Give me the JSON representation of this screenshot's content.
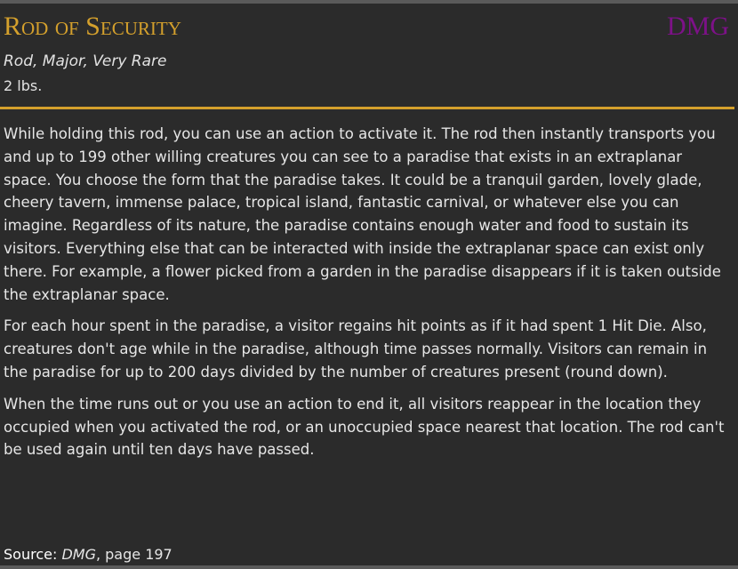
{
  "item": {
    "name": "Rod of Security",
    "source_badge": "DMG",
    "type_line": "Rod, Major, Very Rare",
    "weight": "2 lbs."
  },
  "description": [
    "While holding this rod, you can use an action to activate it. The rod then instantly transports you and up to 199 other willing creatures you can see to a paradise that exists in an extraplanar space. You choose the form that the paradise takes. It could be a tranquil garden, lovely glade, cheery tavern, immense palace, tropical island, fantastic carnival, or whatever else you can imagine. Regardless of its nature, the paradise contains enough water and food to sustain its visitors. Everything else that can be interacted with inside the extraplanar space can exist only there. For example, a flower picked from a garden in the paradise disappears if it is taken outside the extraplanar space.",
    "For each hour spent in the paradise, a visitor regains hit points as if it had spent 1 Hit Die. Also, creatures don't age while in the paradise, although time passes normally. Visitors can remain in the paradise for up to 200 days divided by the number of creatures present (round down).",
    "When the time runs out or you use an action to end it, all visitors reappear in the location they occupied when you activated the rod, or an unoccupied space nearest that location. The rod can't be used again until ten days have passed."
  ],
  "source": {
    "label": "Source:",
    "book": "DMG",
    "page": ", page 197"
  },
  "colors": {
    "accent": "#d4a02c",
    "badge": "#7d1188",
    "background": "#2b2b2b"
  }
}
